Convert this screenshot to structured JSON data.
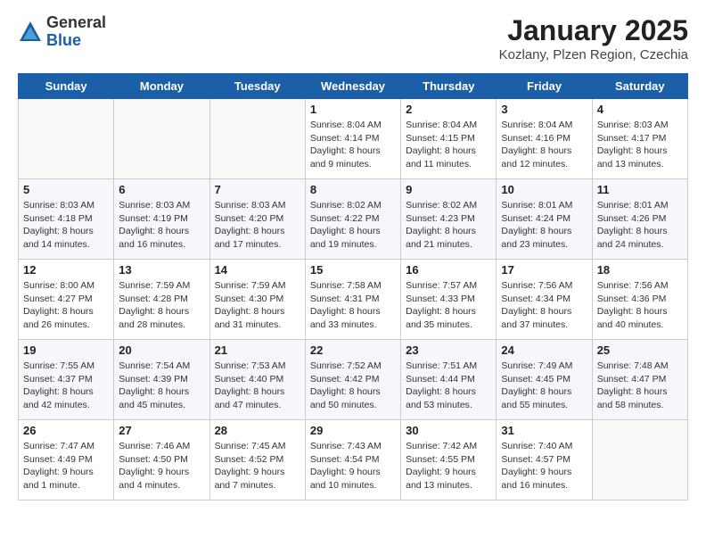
{
  "logo": {
    "general": "General",
    "blue": "Blue"
  },
  "header": {
    "title": "January 2025",
    "subtitle": "Kozlany, Plzen Region, Czechia"
  },
  "days_of_week": [
    "Sunday",
    "Monday",
    "Tuesday",
    "Wednesday",
    "Thursday",
    "Friday",
    "Saturday"
  ],
  "weeks": [
    [
      {
        "day": "",
        "info": ""
      },
      {
        "day": "",
        "info": ""
      },
      {
        "day": "",
        "info": ""
      },
      {
        "day": "1",
        "info": "Sunrise: 8:04 AM\nSunset: 4:14 PM\nDaylight: 8 hours and 9 minutes."
      },
      {
        "day": "2",
        "info": "Sunrise: 8:04 AM\nSunset: 4:15 PM\nDaylight: 8 hours and 11 minutes."
      },
      {
        "day": "3",
        "info": "Sunrise: 8:04 AM\nSunset: 4:16 PM\nDaylight: 8 hours and 12 minutes."
      },
      {
        "day": "4",
        "info": "Sunrise: 8:03 AM\nSunset: 4:17 PM\nDaylight: 8 hours and 13 minutes."
      }
    ],
    [
      {
        "day": "5",
        "info": "Sunrise: 8:03 AM\nSunset: 4:18 PM\nDaylight: 8 hours and 14 minutes."
      },
      {
        "day": "6",
        "info": "Sunrise: 8:03 AM\nSunset: 4:19 PM\nDaylight: 8 hours and 16 minutes."
      },
      {
        "day": "7",
        "info": "Sunrise: 8:03 AM\nSunset: 4:20 PM\nDaylight: 8 hours and 17 minutes."
      },
      {
        "day": "8",
        "info": "Sunrise: 8:02 AM\nSunset: 4:22 PM\nDaylight: 8 hours and 19 minutes."
      },
      {
        "day": "9",
        "info": "Sunrise: 8:02 AM\nSunset: 4:23 PM\nDaylight: 8 hours and 21 minutes."
      },
      {
        "day": "10",
        "info": "Sunrise: 8:01 AM\nSunset: 4:24 PM\nDaylight: 8 hours and 23 minutes."
      },
      {
        "day": "11",
        "info": "Sunrise: 8:01 AM\nSunset: 4:26 PM\nDaylight: 8 hours and 24 minutes."
      }
    ],
    [
      {
        "day": "12",
        "info": "Sunrise: 8:00 AM\nSunset: 4:27 PM\nDaylight: 8 hours and 26 minutes."
      },
      {
        "day": "13",
        "info": "Sunrise: 7:59 AM\nSunset: 4:28 PM\nDaylight: 8 hours and 28 minutes."
      },
      {
        "day": "14",
        "info": "Sunrise: 7:59 AM\nSunset: 4:30 PM\nDaylight: 8 hours and 31 minutes."
      },
      {
        "day": "15",
        "info": "Sunrise: 7:58 AM\nSunset: 4:31 PM\nDaylight: 8 hours and 33 minutes."
      },
      {
        "day": "16",
        "info": "Sunrise: 7:57 AM\nSunset: 4:33 PM\nDaylight: 8 hours and 35 minutes."
      },
      {
        "day": "17",
        "info": "Sunrise: 7:56 AM\nSunset: 4:34 PM\nDaylight: 8 hours and 37 minutes."
      },
      {
        "day": "18",
        "info": "Sunrise: 7:56 AM\nSunset: 4:36 PM\nDaylight: 8 hours and 40 minutes."
      }
    ],
    [
      {
        "day": "19",
        "info": "Sunrise: 7:55 AM\nSunset: 4:37 PM\nDaylight: 8 hours and 42 minutes."
      },
      {
        "day": "20",
        "info": "Sunrise: 7:54 AM\nSunset: 4:39 PM\nDaylight: 8 hours and 45 minutes."
      },
      {
        "day": "21",
        "info": "Sunrise: 7:53 AM\nSunset: 4:40 PM\nDaylight: 8 hours and 47 minutes."
      },
      {
        "day": "22",
        "info": "Sunrise: 7:52 AM\nSunset: 4:42 PM\nDaylight: 8 hours and 50 minutes."
      },
      {
        "day": "23",
        "info": "Sunrise: 7:51 AM\nSunset: 4:44 PM\nDaylight: 8 hours and 53 minutes."
      },
      {
        "day": "24",
        "info": "Sunrise: 7:49 AM\nSunset: 4:45 PM\nDaylight: 8 hours and 55 minutes."
      },
      {
        "day": "25",
        "info": "Sunrise: 7:48 AM\nSunset: 4:47 PM\nDaylight: 8 hours and 58 minutes."
      }
    ],
    [
      {
        "day": "26",
        "info": "Sunrise: 7:47 AM\nSunset: 4:49 PM\nDaylight: 9 hours and 1 minute."
      },
      {
        "day": "27",
        "info": "Sunrise: 7:46 AM\nSunset: 4:50 PM\nDaylight: 9 hours and 4 minutes."
      },
      {
        "day": "28",
        "info": "Sunrise: 7:45 AM\nSunset: 4:52 PM\nDaylight: 9 hours and 7 minutes."
      },
      {
        "day": "29",
        "info": "Sunrise: 7:43 AM\nSunset: 4:54 PM\nDaylight: 9 hours and 10 minutes."
      },
      {
        "day": "30",
        "info": "Sunrise: 7:42 AM\nSunset: 4:55 PM\nDaylight: 9 hours and 13 minutes."
      },
      {
        "day": "31",
        "info": "Sunrise: 7:40 AM\nSunset: 4:57 PM\nDaylight: 9 hours and 16 minutes."
      },
      {
        "day": "",
        "info": ""
      }
    ]
  ]
}
